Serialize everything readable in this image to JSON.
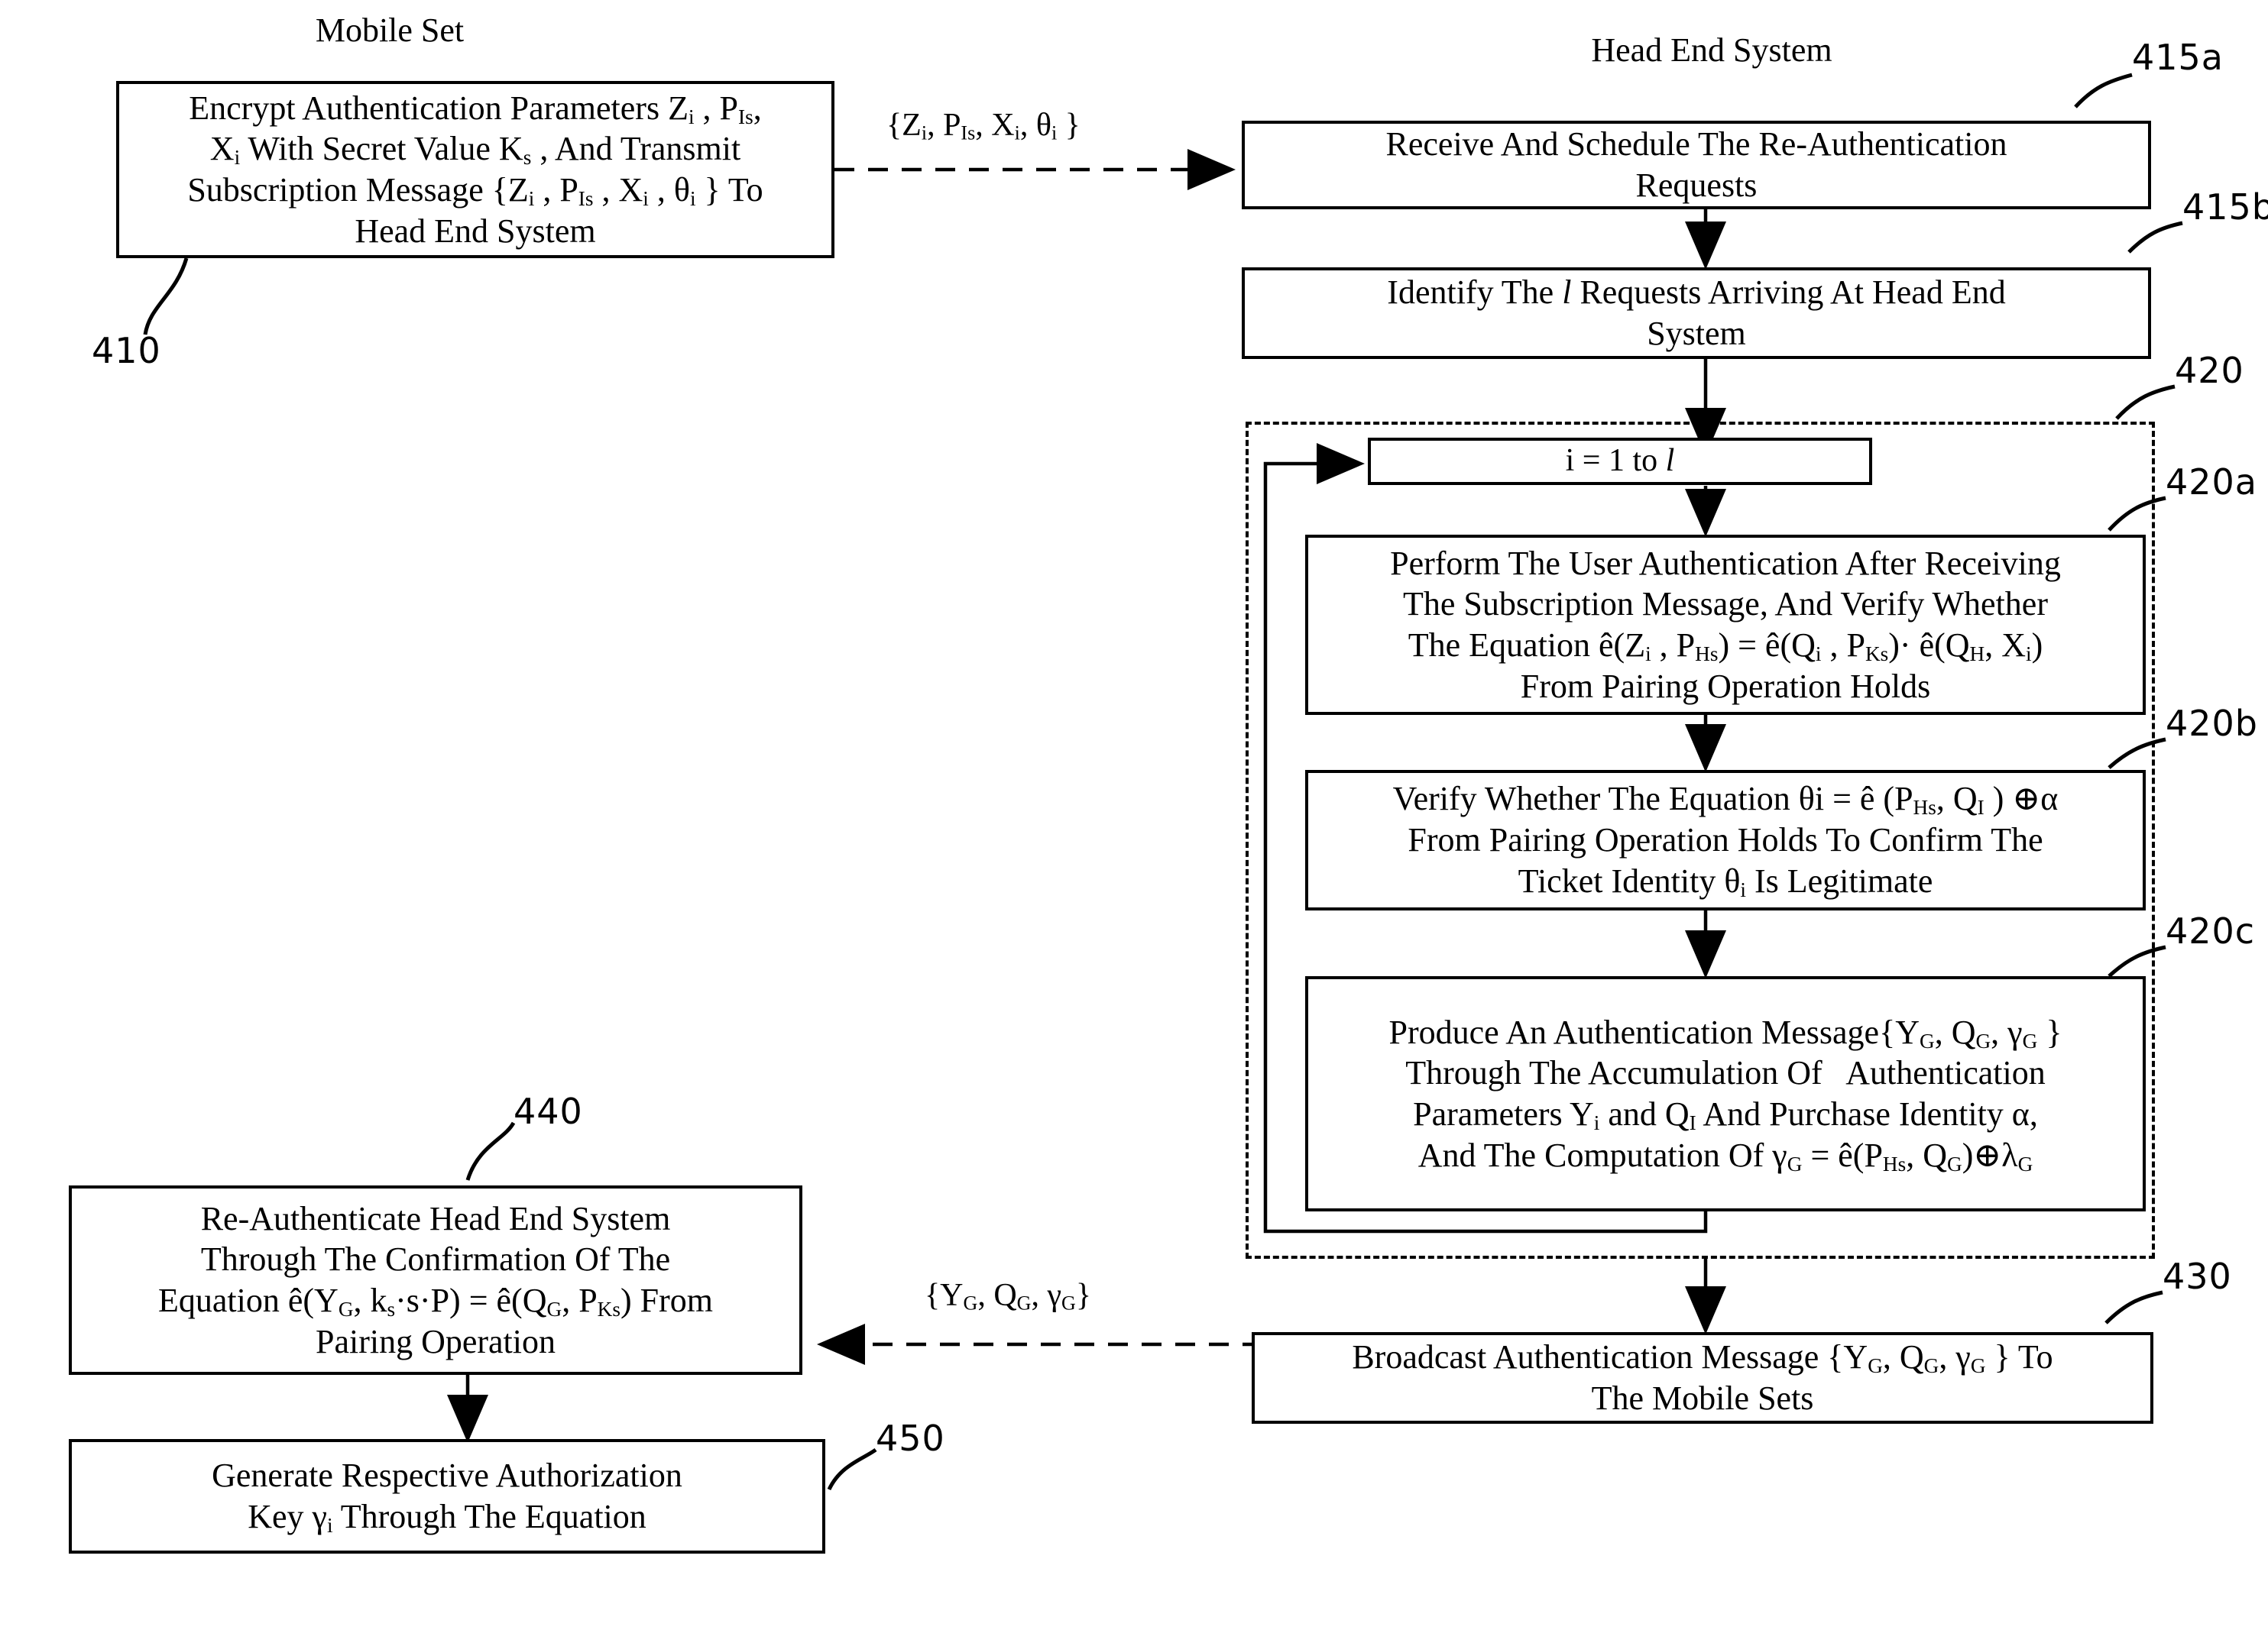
{
  "diagram": {
    "title_left": "Mobile Set",
    "title_right": "Head End System",
    "refs": {
      "r410": "410",
      "r415a": "415a",
      "r415b": "415b",
      "r420": "420",
      "r420a": "420a",
      "r420b": "420b",
      "r420c": "420c",
      "r430": "430",
      "r440": "440",
      "r450": "450"
    },
    "flow_labels": {
      "subscription_msg": "{Zi, PIs, Xi, θi }",
      "auth_msg": "{YG, QG, γG}"
    },
    "boxes": {
      "b410": {
        "lines": [
          "Encrypt Authentication Parameters Z i , P Is ,",
          "X i With Secret Value K s , And Transmit",
          "Subscription Message {Z i , P Is , X i , θ i } To",
          "Head End System"
        ]
      },
      "b415a": {
        "lines": [
          "Receive And Schedule The Re-Authentication",
          "Requests"
        ]
      },
      "b415b": {
        "lines": [
          "Identify The l Requests Arriving At Head End",
          "System"
        ]
      },
      "loop": {
        "lines": [
          "i = 1 to l"
        ]
      },
      "b420a": {
        "lines": [
          "Perform The User Authentication After Receiving",
          "The Subscription Message, And Verify Whether",
          "The Equation ê(Z i , P Hs ) = ê(Q i , P Ks )· ê(Q H , X i )",
          "From Pairing Operation Holds"
        ]
      },
      "b420b": {
        "lines": [
          "Verify Whether The Equation θi = ê (P Hs , Q I ) ⊕ α",
          "From Pairing Operation Holds To Confirm The",
          "Ticket Identity θ i Is Legitimate"
        ]
      },
      "b420c": {
        "lines": [
          "Produce An Authentication Message {Y G , Q G , γ G }",
          "Through The Accumulation Of   Authentication",
          "Parameters Y i and Q I And Purchase Identity α,",
          "And The Computation Of γ G = ê(P Hs , Q G ) ⊕ λ G"
        ]
      },
      "b430": {
        "lines": [
          "Broadcast Authentication Message {Y G , Q G , γ G } To",
          "The Mobile Sets"
        ]
      },
      "b440": {
        "lines": [
          "Re-Authenticate Head End System",
          "Through The Confirmation Of The",
          "Equation ê(Y G , k s ·s·P) = ê(Q G , P Ks ) From",
          "Pairing Operation"
        ]
      },
      "b450": {
        "lines": [
          "Generate Respective Authorization",
          "Key γ i Through The Equation"
        ]
      }
    }
  }
}
